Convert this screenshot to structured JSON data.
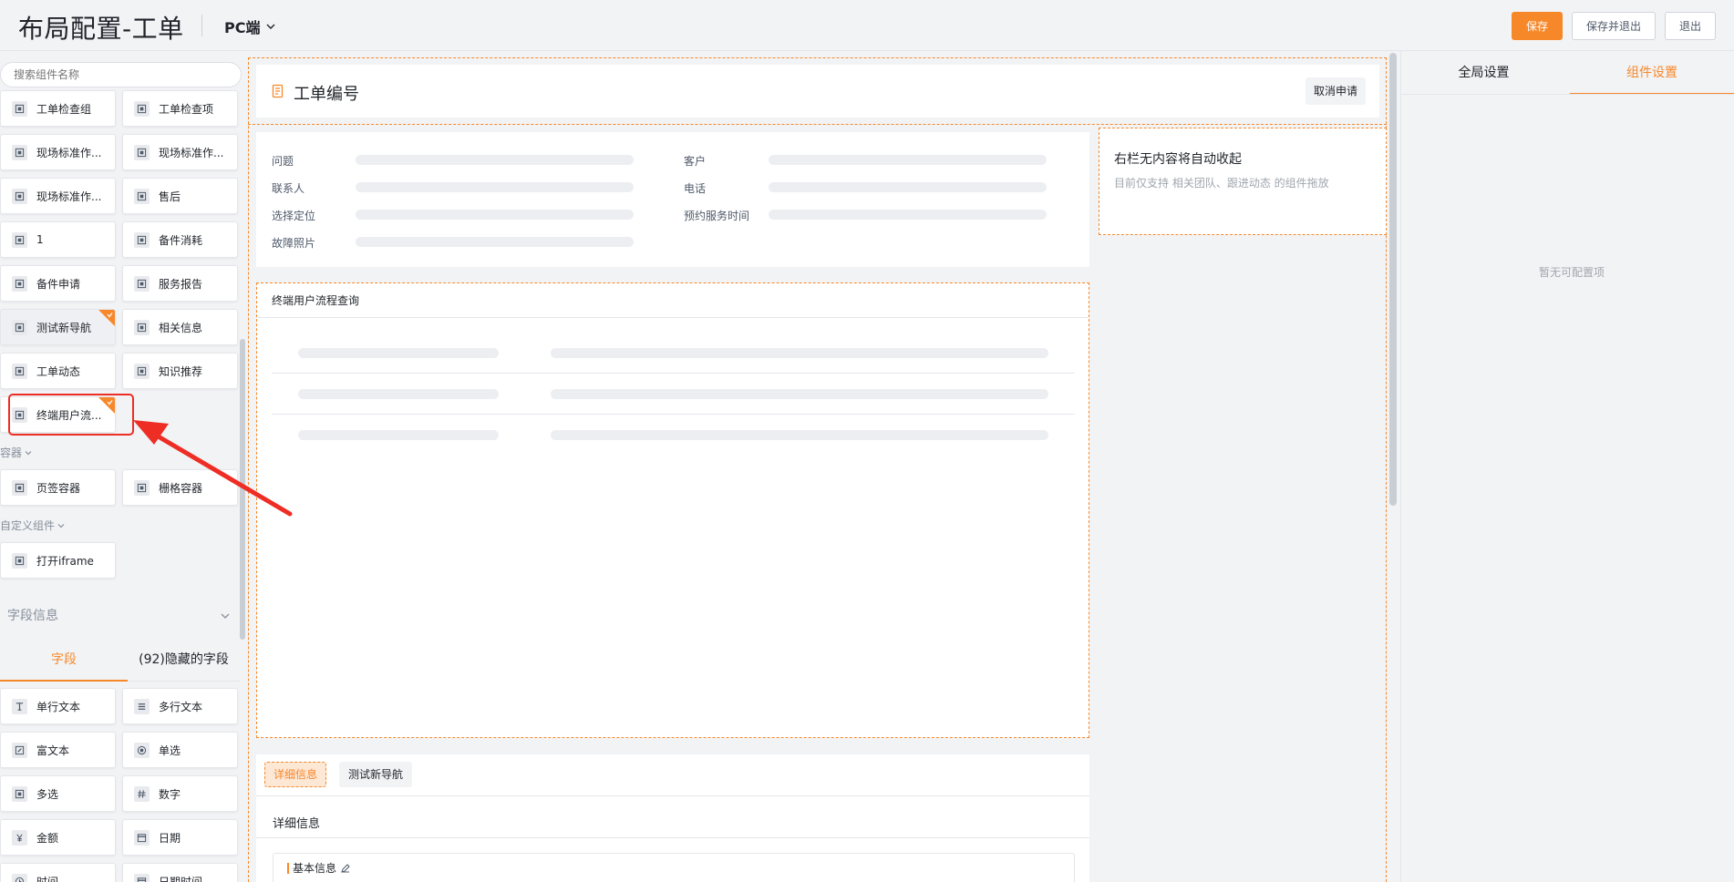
{
  "header": {
    "title": "布局配置-工单",
    "platform": "PC端",
    "save": "保存",
    "save_exit": "保存并退出",
    "exit": "退出"
  },
  "left": {
    "search_placeholder": "搜索组件名称",
    "components": [
      {
        "label": "工单检查组"
      },
      {
        "label": "工单检查项"
      },
      {
        "label": "现场标准作..."
      },
      {
        "label": "现场标准作..."
      },
      {
        "label": "现场标准作..."
      },
      {
        "label": "售后"
      },
      {
        "label": "1"
      },
      {
        "label": "备件消耗"
      },
      {
        "label": "备件申请"
      },
      {
        "label": "服务报告"
      },
      {
        "label": "测试新导航"
      },
      {
        "label": "相关信息"
      },
      {
        "label": "工单动态"
      },
      {
        "label": "知识推荐"
      },
      {
        "label": "终端用户流..."
      }
    ],
    "container_section": "容器",
    "containers": [
      {
        "label": "页签容器"
      },
      {
        "label": "栅格容器"
      }
    ],
    "custom_section": "自定义组件",
    "custom": [
      {
        "label": "打开iframe"
      }
    ],
    "field_info": "字段信息",
    "field_tabs": {
      "fields": "字段",
      "hidden": "(92)隐藏的字段"
    },
    "fields": [
      {
        "label": "单行文本",
        "icon": "text-icon"
      },
      {
        "label": "多行文本",
        "icon": "lines-icon"
      },
      {
        "label": "富文本",
        "icon": "rich-text-icon"
      },
      {
        "label": "单选",
        "icon": "radio-icon"
      },
      {
        "label": "多选",
        "icon": "checkbox-icon"
      },
      {
        "label": "数字",
        "icon": "hash-icon"
      },
      {
        "label": "金额",
        "icon": "yen-icon"
      },
      {
        "label": "日期",
        "icon": "calendar-icon"
      },
      {
        "label": "时间",
        "icon": "clock-icon"
      },
      {
        "label": "日期时间",
        "icon": "calendar-icon"
      }
    ]
  },
  "canvas": {
    "header_title": "工单编号",
    "cancel_button": "取消申请",
    "info_fields": {
      "problem": "问题",
      "customer": "客户",
      "contact": "联系人",
      "phone": "电话",
      "location": "选择定位",
      "appointment": "预约服务时间",
      "photos": "故障照片"
    },
    "right_col_title": "右栏无内容将自动收起",
    "right_col_sub": "目前仅支持 相关团队、跟进动态 的组件拖放",
    "flow_title": "终端用户流程查询",
    "tabs": [
      "详细信息",
      "测试新导航"
    ],
    "detail_title": "详细信息",
    "basic_info": "基本信息"
  },
  "settings": {
    "tab_global": "全局设置",
    "tab_component": "组件设置",
    "empty": "暂无可配置项"
  },
  "colors": {
    "accent": "#f7882a",
    "annotation": "#ee2d24"
  }
}
